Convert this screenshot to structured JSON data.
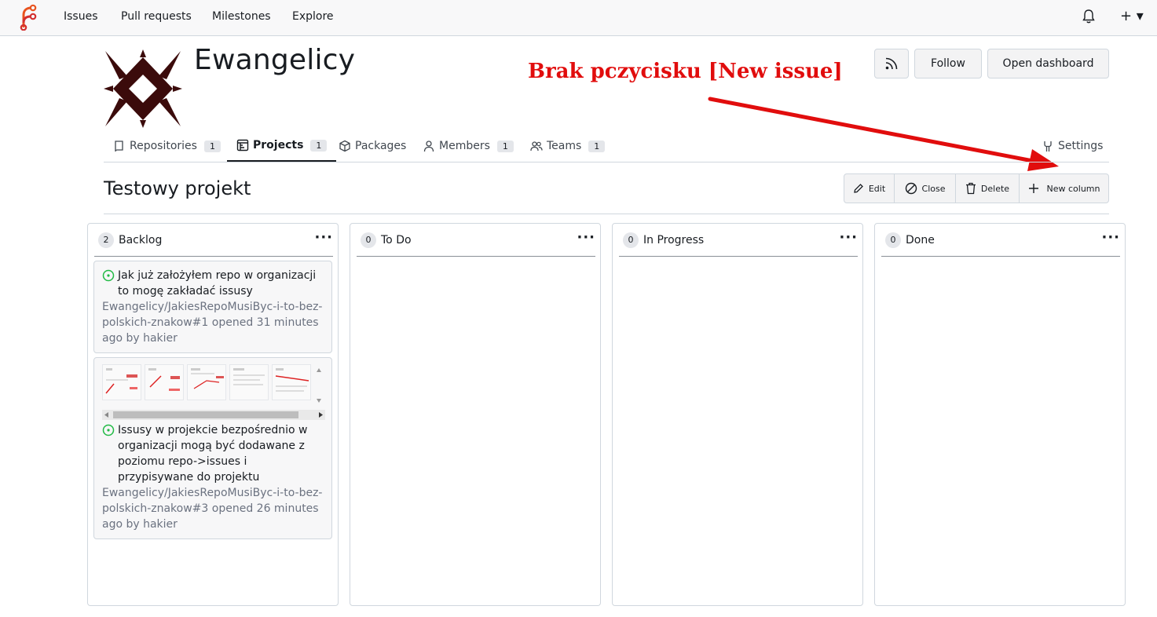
{
  "navbar": {
    "links": [
      "Issues",
      "Pull requests",
      "Milestones",
      "Explore"
    ],
    "plus_label": "+ ▾"
  },
  "org": {
    "name": "Ewangelicy",
    "rss_icon": "rss-icon",
    "follow_label": "Follow",
    "dashboard_label": "Open dashboard"
  },
  "annotation": {
    "text": "Brak pczycisku [New issue]",
    "color": "#e10d0d"
  },
  "tabs": [
    {
      "label": "Repositories",
      "count": "1",
      "icon": "repo-icon"
    },
    {
      "label": "Projects",
      "count": "1",
      "icon": "project-icon",
      "active": true
    },
    {
      "label": "Packages",
      "icon": "package-icon"
    },
    {
      "label": "Members",
      "count": "1",
      "icon": "person-icon"
    },
    {
      "label": "Teams",
      "count": "1",
      "icon": "people-icon"
    },
    {
      "label": "Settings",
      "icon": "tools-icon"
    }
  ],
  "project": {
    "title": "Testowy projekt",
    "actions": [
      "Edit",
      "Close",
      "Delete",
      "New column"
    ]
  },
  "columns": [
    {
      "count": "2",
      "title": "Backlog"
    },
    {
      "count": "0",
      "title": "To Do"
    },
    {
      "count": "0",
      "title": "In Progress"
    },
    {
      "count": "0",
      "title": "Done"
    }
  ],
  "cards": [
    {
      "title": "Jak już założyłem repo w organizacji to mogę zakładać issusy",
      "meta": "Ewangelicy/JakiesRepoMusiByc-i-to-bez-polskich-znakow#1 opened 31 minutes ago by hakier"
    },
    {
      "title": "Issusy w projekcie bezpośrednio w organizacji mogą być dodawane z poziomu repo->issues i przypisywane do projektu",
      "meta": "Ewangelicy/JakiesRepoMusiByc-i-to-bez-polskich-znakow#3 opened 26 minutes ago by hakier"
    }
  ],
  "colors": {
    "accent_logo": "#e8531f",
    "issue_open": "#21ba45",
    "annotation_red": "#e10d0d"
  }
}
